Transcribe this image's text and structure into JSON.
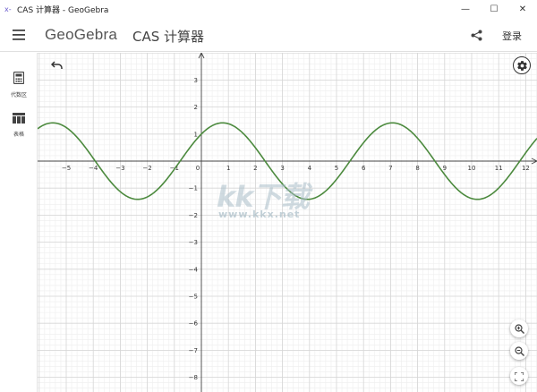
{
  "window": {
    "title": "CAS 计算器 - GeoGebra",
    "minimize": "—",
    "maximize": "☐",
    "close": "✕"
  },
  "header": {
    "logo": "GeoGebra",
    "app_title": "CAS 计算器",
    "login": "登录",
    "menu_icon": "hamburger-menu-icon",
    "share_icon": "share-icon"
  },
  "sidebar": {
    "items": [
      {
        "label": "代数区",
        "icon": "calculator-icon"
      },
      {
        "label": "表格",
        "icon": "table-icon"
      }
    ]
  },
  "graph": {
    "x_tick_labels": [
      "−5",
      "−4",
      "−3",
      "−2",
      "−1",
      "0",
      "1",
      "2",
      "3",
      "4",
      "5",
      "6",
      "7",
      "8",
      "9",
      "10",
      "11",
      "12"
    ],
    "y_tick_labels": [
      "3",
      "2",
      "1",
      "−1",
      "−2",
      "−3",
      "−4",
      "−5",
      "−6",
      "−7",
      "−8"
    ],
    "curve_color": "#4c8a3e",
    "undo_icon": "undo-icon",
    "settings_icon": "gear-icon",
    "zoom_in_icon": "zoom-in-icon",
    "zoom_out_icon": "zoom-out-icon",
    "fullscreen_icon": "fullscreen-icon"
  },
  "watermark": {
    "big": "kk下载",
    "small": "www.kkx.net"
  }
}
